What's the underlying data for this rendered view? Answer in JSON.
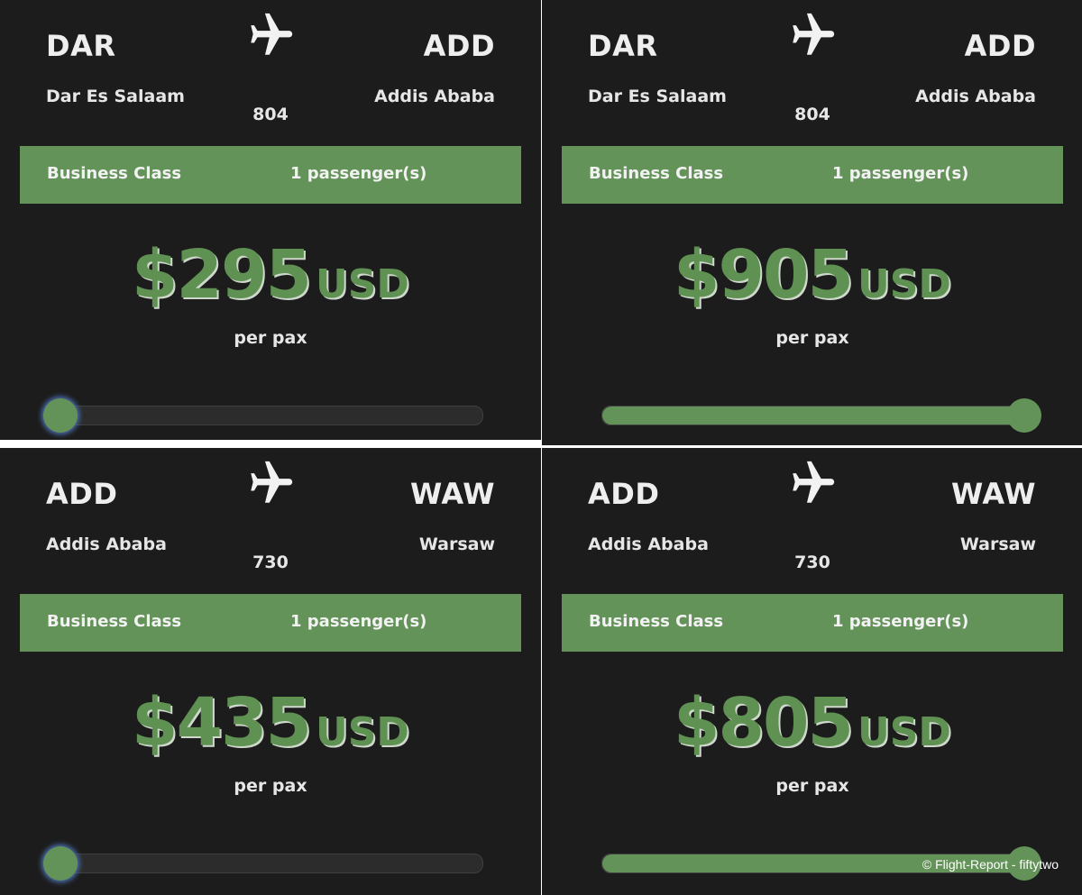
{
  "accent_color": "#64935a",
  "panels": [
    {
      "origin_code": "DAR",
      "origin_city": "Dar Es Salaam",
      "dest_code": "ADD",
      "dest_city": "Addis Ababa",
      "flight_no": "804",
      "cabin": "Business Class",
      "passengers": "1 passenger(s)",
      "price": "$295",
      "currency": "USD",
      "per_pax": "per pax",
      "slider_fraction": 0.0
    },
    {
      "origin_code": "DAR",
      "origin_city": "Dar Es Salaam",
      "dest_code": "ADD",
      "dest_city": "Addis Ababa",
      "flight_no": "804",
      "cabin": "Business Class",
      "passengers": "1 passenger(s)",
      "price": "$905",
      "currency": "USD",
      "per_pax": "per pax",
      "slider_fraction": 1.0
    },
    {
      "origin_code": "ADD",
      "origin_city": "Addis Ababa",
      "dest_code": "WAW",
      "dest_city": "Warsaw",
      "flight_no": "730",
      "cabin": "Business Class",
      "passengers": "1 passenger(s)",
      "price": "$435",
      "currency": "USD",
      "per_pax": "per pax",
      "slider_fraction": 0.0
    },
    {
      "origin_code": "ADD",
      "origin_city": "Addis Ababa",
      "dest_code": "WAW",
      "dest_city": "Warsaw",
      "flight_no": "730",
      "cabin": "Business Class",
      "passengers": "1 passenger(s)",
      "price": "$805",
      "currency": "USD",
      "per_pax": "per pax",
      "slider_fraction": 1.0
    }
  ],
  "icons": {
    "flight": "airplane-icon"
  },
  "watermark": "© Flight-Report - fiftytwo"
}
